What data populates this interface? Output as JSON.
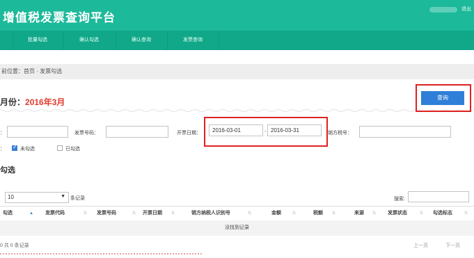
{
  "header": {
    "title": "增值税发票查询平台",
    "user_text": "退出"
  },
  "nav": {
    "items": [
      {
        "label": ""
      },
      {
        "label": "批量勾选"
      },
      {
        "label": "确认勾选"
      },
      {
        "label": "确认查询"
      },
      {
        "label": "发票查询"
      }
    ]
  },
  "breadcrumb": {
    "prefix": "前位置：",
    "home": "首页",
    "sep": " - ",
    "current": "发票勾选"
  },
  "period": {
    "label": "月份：",
    "value": "2016年3月"
  },
  "query_button": "查询",
  "filters": {
    "invoice_no_label": "发票号码：",
    "date_label": "开票日期：",
    "date_from": "2016-03-01",
    "date_sep": "-",
    "date_to": "2016-03-31",
    "seller_tax_label": "销方税号：",
    "status_prefix": "：",
    "unchecked_label": "未勾选",
    "checked_label": "已勾选"
  },
  "section": {
    "title": "勾选"
  },
  "table_controls": {
    "page_size": "10",
    "page_size_suffix": "条记录",
    "search_label": "搜索:"
  },
  "table": {
    "columns": [
      "勾选",
      "发票代码",
      "发票号码",
      "开票日期",
      "销方纳税人识别号",
      "金额",
      "税额",
      "来源",
      "发票状态",
      "勾选标志"
    ],
    "empty_text": "没找到记录"
  },
  "footer": {
    "info": "0 共 0 条记录",
    "prev": "上一页",
    "next": "下一页"
  }
}
